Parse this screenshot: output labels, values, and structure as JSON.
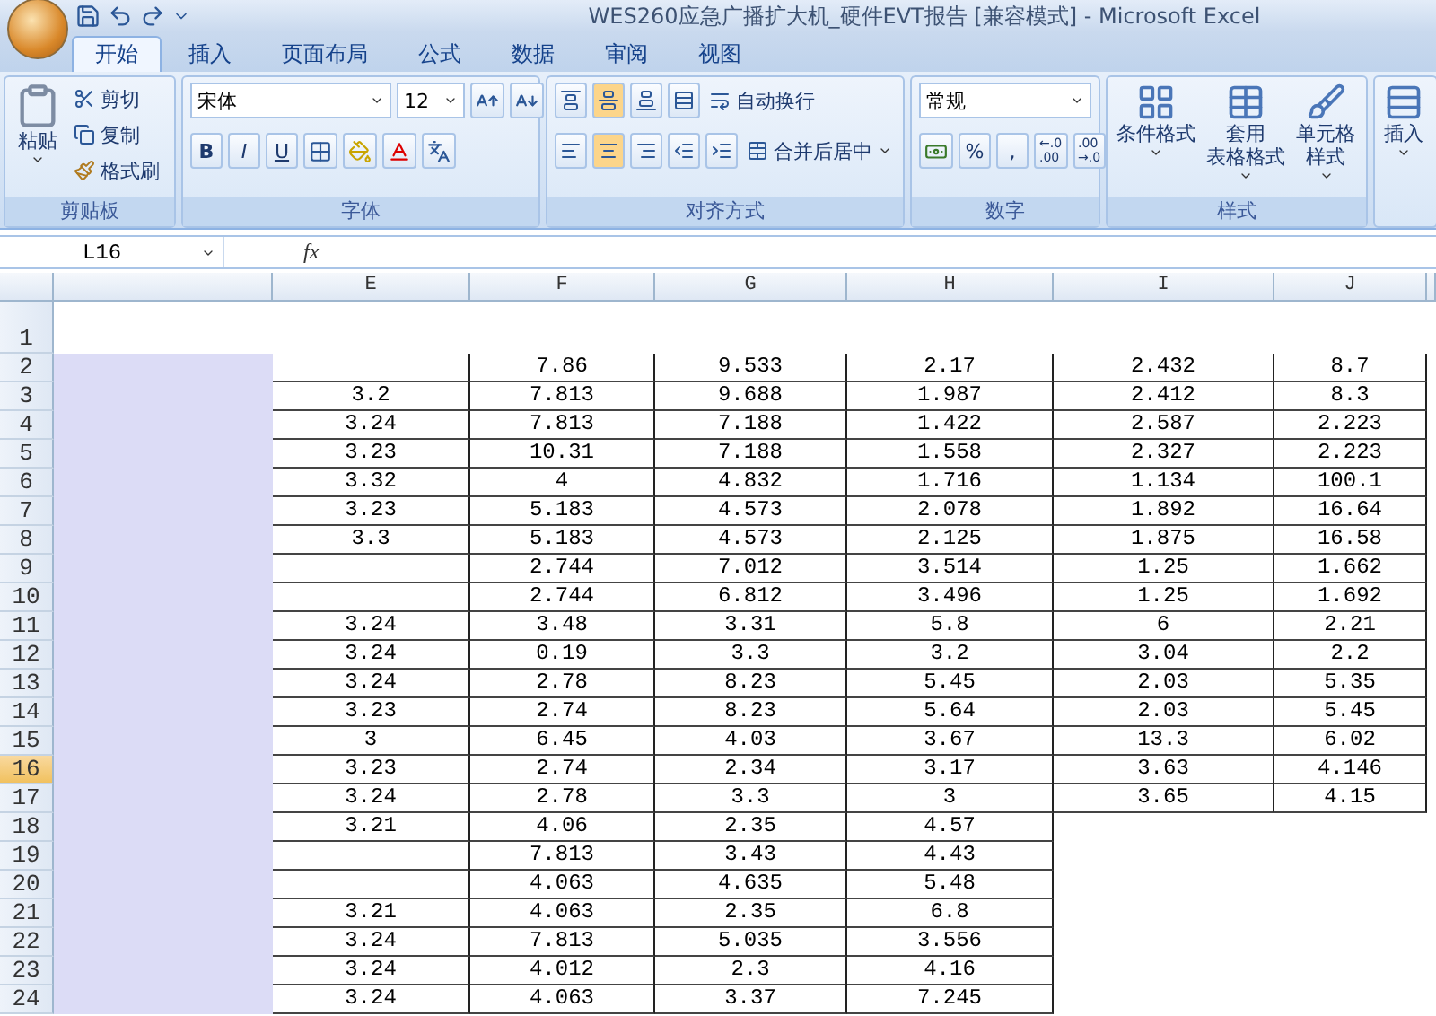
{
  "window": {
    "title": "WES260应急广播扩大机_硬件EVT报告  [兼容模式] - Microsoft Excel"
  },
  "tabs": [
    {
      "label": "开始",
      "selected": true
    },
    {
      "label": "插入",
      "selected": false
    },
    {
      "label": "页面布局",
      "selected": false
    },
    {
      "label": "公式",
      "selected": false
    },
    {
      "label": "数据",
      "selected": false
    },
    {
      "label": "审阅",
      "selected": false
    },
    {
      "label": "视图",
      "selected": false
    }
  ],
  "ribbon": {
    "clipboard": {
      "title": "剪贴板",
      "paste": "粘贴",
      "cut": "剪切",
      "copy": "复制",
      "format_painter": "格式刷"
    },
    "font": {
      "title": "字体",
      "font_name": "宋体",
      "font_size": "12",
      "style_buttons": [
        "B",
        "I",
        "U"
      ]
    },
    "alignment": {
      "title": "对齐方式",
      "vertical": [
        {
          "selected": false
        },
        {
          "selected": true
        },
        {
          "selected": false
        }
      ],
      "horizontal": [
        {
          "selected": false
        },
        {
          "selected": true
        },
        {
          "selected": false
        }
      ],
      "wrap_text": "自动换行",
      "merge_center": "合并后居中"
    },
    "number": {
      "title": "数字",
      "format": "常规",
      "percent": "%",
      "comma": ",",
      "decimals": [
        {
          "top": "←.0",
          "bottom": ".00"
        },
        {
          "top": ".00",
          "bottom": "→.0"
        }
      ]
    },
    "styles": {
      "title": "样式",
      "buttons": [
        [
          "条件格式"
        ],
        [
          "套用",
          "表格格式"
        ],
        [
          "单元格",
          "样式"
        ]
      ]
    },
    "cells": {
      "insert": "插入"
    }
  },
  "formula_bar": {
    "name_box": "L16",
    "fx": "fx"
  },
  "sheet": {
    "columns": [
      "E",
      "F",
      "G",
      "H",
      "I",
      "J"
    ],
    "rows": [
      {
        "number": "1",
        "selected": false,
        "cells": [
          "",
          "",
          "",
          "",
          "",
          ""
        ]
      },
      {
        "number": "2",
        "selected": false,
        "cells": [
          "",
          "7.86",
          "9.533",
          "2.17",
          "2.432",
          "8.7"
        ]
      },
      {
        "number": "3",
        "selected": false,
        "cells": [
          "3.2",
          "7.813",
          "9.688",
          "1.987",
          "2.412",
          "8.3"
        ]
      },
      {
        "number": "4",
        "selected": false,
        "cells": [
          "3.24",
          "7.813",
          "7.188",
          "1.422",
          "2.587",
          "2.223"
        ]
      },
      {
        "number": "5",
        "selected": false,
        "cells": [
          "3.23",
          "10.31",
          "7.188",
          "1.558",
          "2.327",
          "2.223"
        ]
      },
      {
        "number": "6",
        "selected": false,
        "cells": [
          "3.32",
          "4",
          "4.832",
          "1.716",
          "1.134",
          "100.1"
        ]
      },
      {
        "number": "7",
        "selected": false,
        "cells": [
          "3.23",
          "5.183",
          "4.573",
          "2.078",
          "1.892",
          "16.64"
        ]
      },
      {
        "number": "8",
        "selected": false,
        "cells": [
          "3.3",
          "5.183",
          "4.573",
          "2.125",
          "1.875",
          "16.58"
        ]
      },
      {
        "number": "9",
        "selected": false,
        "cells": [
          "",
          "2.744",
          "7.012",
          "3.514",
          "1.25",
          "1.662"
        ]
      },
      {
        "number": "10",
        "selected": false,
        "cells": [
          "",
          "2.744",
          "6.812",
          "3.496",
          "1.25",
          "1.692"
        ]
      },
      {
        "number": "11",
        "selected": false,
        "cells": [
          "3.24",
          "3.48",
          "3.31",
          "5.8",
          "6",
          "2.21"
        ]
      },
      {
        "number": "12",
        "selected": false,
        "cells": [
          "3.24",
          "0.19",
          "3.3",
          "3.2",
          "3.04",
          "2.2"
        ]
      },
      {
        "number": "13",
        "selected": false,
        "cells": [
          "3.24",
          "2.78",
          "8.23",
          "5.45",
          "2.03",
          "5.35"
        ]
      },
      {
        "number": "14",
        "selected": false,
        "cells": [
          "3.23",
          "2.74",
          "8.23",
          "5.64",
          "2.03",
          "5.45"
        ]
      },
      {
        "number": "15",
        "selected": false,
        "cells": [
          "3",
          "6.45",
          "4.03",
          "3.67",
          "13.3",
          "6.02"
        ]
      },
      {
        "number": "16",
        "selected": true,
        "cells": [
          "3.23",
          "2.74",
          "2.34",
          "3.17",
          "3.63",
          "4.146"
        ]
      },
      {
        "number": "17",
        "selected": false,
        "cells": [
          "3.24",
          "2.78",
          "3.3",
          "3",
          "3.65",
          "4.15"
        ]
      },
      {
        "number": "18",
        "selected": false,
        "cells": [
          "3.21",
          "4.06",
          "2.35",
          "4.57"
        ]
      },
      {
        "number": "19",
        "selected": false,
        "cells": [
          "",
          "7.813",
          "3.43",
          "4.43"
        ]
      },
      {
        "number": "20",
        "selected": false,
        "cells": [
          "",
          "4.063",
          "4.635",
          "5.48"
        ]
      },
      {
        "number": "21",
        "selected": false,
        "cells": [
          "3.21",
          "4.063",
          "2.35",
          "6.8"
        ]
      },
      {
        "number": "22",
        "selected": false,
        "cells": [
          "3.24",
          "7.813",
          "5.035",
          "3.556"
        ]
      },
      {
        "number": "23",
        "selected": false,
        "cells": [
          "3.24",
          "4.012",
          "2.3",
          "4.16"
        ]
      },
      {
        "number": "24",
        "selected": false,
        "cells": [
          "3.24",
          "4.063",
          "3.37",
          "7.245"
        ]
      }
    ]
  }
}
